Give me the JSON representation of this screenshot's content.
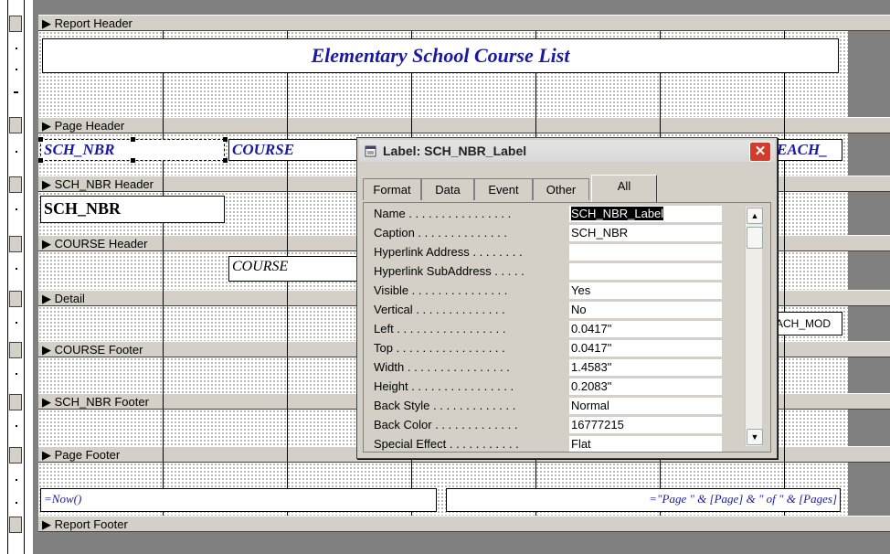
{
  "sections": {
    "report_header": "Report Header",
    "page_header": "Page Header",
    "sch_nbr_header": "SCH_NBR Header",
    "course_header": "COURSE Header",
    "detail": "Detail",
    "course_footer": "COURSE Footer",
    "sch_nbr_footer": "SCH_NBR Footer",
    "page_footer": "Page Footer",
    "report_footer": "Report Footer"
  },
  "controls": {
    "report_title": "Elementary School Course List",
    "sch_nbr_label": "SCH_NBR",
    "course_label": "COURSE",
    "teach_label_partial": "EACH_",
    "sch_nbr_textbox": "SCH_NBR",
    "course_textbox": "COURSE",
    "teach_mod_partial": "ACH_MOD",
    "now_expr": "=Now()",
    "page_expr": "=\"Page \" & [Page] & \" of \" & [Pages]"
  },
  "dialog": {
    "title": "Label: SCH_NBR_Label",
    "close": "✕",
    "tabs": [
      "Format",
      "Data",
      "Event",
      "Other",
      "All"
    ],
    "active_tab": "All",
    "properties": [
      {
        "name": "Name . . . . . . . . . . . . . . . .",
        "value": "SCH_NBR_Label"
      },
      {
        "name": "Caption . . . . . . . . . . . . . .",
        "value": "SCH_NBR"
      },
      {
        "name": "Hyperlink Address . . . . . . . .",
        "value": ""
      },
      {
        "name": "Hyperlink SubAddress . . . . .",
        "value": ""
      },
      {
        "name": "Visible . . . . . . . . . . . . . . .",
        "value": "Yes"
      },
      {
        "name": "Vertical . . . . . . . . . . . . . .",
        "value": "No"
      },
      {
        "name": "Left . . . . . . . . . . . . . . . . .",
        "value": "0.0417\""
      },
      {
        "name": "Top . . . . . . . . . . . . . . . . .",
        "value": "0.0417\""
      },
      {
        "name": "Width . . . . . . . . . . . . . . . .",
        "value": "1.4583\""
      },
      {
        "name": "Height . . . . . . . . . . . . . . . .",
        "value": "0.2083\""
      },
      {
        "name": "Back Style . . . . . . . . . . . . .",
        "value": "Normal"
      },
      {
        "name": "Back Color . . . . . . . . . . . . .",
        "value": "16777215"
      },
      {
        "name": "Special Effect . . . . . . . . . . .",
        "value": "Flat"
      }
    ]
  },
  "colors": {
    "label_text": "#1a1aa0",
    "close_button": "#d23c2c",
    "canvas": "#808080"
  }
}
